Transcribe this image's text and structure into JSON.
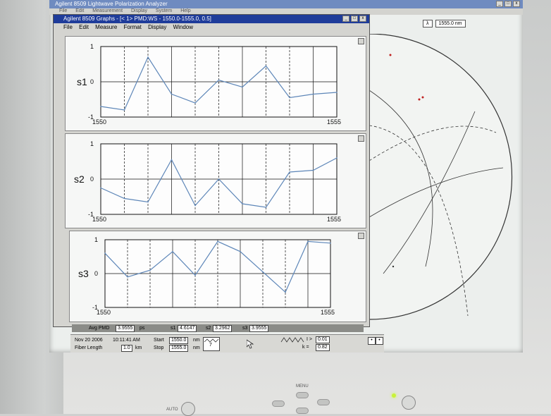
{
  "app": {
    "title": "Agilent 8509  Lightwave Polarization Analyzer",
    "menus": [
      "File",
      "Edit",
      "Measurement",
      "Display",
      "System",
      "Help"
    ],
    "win_buttons": [
      "_",
      "□",
      "x"
    ]
  },
  "lambda": {
    "symbol": "λ",
    "value": "1555.0 nm"
  },
  "graphs_window": {
    "title": "Agilent 8509 Graphs - [< 1> PMD:WS - 1550.0-1555.0, 0.5]",
    "menus": [
      "File",
      "Edit",
      "Measure",
      "Format",
      "Display",
      "Window"
    ],
    "win_buttons": [
      "_",
      "□",
      "x"
    ]
  },
  "chart_data": [
    {
      "type": "line",
      "ylabel": "s1",
      "x": [
        1550,
        1550.5,
        1551,
        1551.5,
        1552,
        1552.5,
        1553,
        1553.5,
        1554,
        1554.5,
        1555
      ],
      "values": [
        -0.7,
        -0.8,
        0.7,
        -0.35,
        -0.6,
        0.05,
        -0.15,
        0.45,
        -0.45,
        -0.35,
        -0.3
      ],
      "ylim": [
        -1,
        1
      ],
      "xlim": [
        1550,
        1555
      ],
      "yticks": [
        "1",
        "0",
        "-1"
      ],
      "xticks": [
        "1550",
        "1555"
      ]
    },
    {
      "type": "line",
      "ylabel": "s2",
      "x": [
        1550,
        1550.5,
        1551,
        1551.5,
        1552,
        1552.5,
        1553,
        1553.5,
        1554,
        1554.5,
        1555
      ],
      "values": [
        -0.25,
        -0.55,
        -0.65,
        0.55,
        -0.75,
        0.0,
        -0.7,
        -0.8,
        0.2,
        0.25,
        0.6
      ],
      "ylim": [
        -1,
        1
      ],
      "xlim": [
        1550,
        1555
      ],
      "yticks": [
        "1",
        "0",
        "-1"
      ],
      "xticks": [
        "1550",
        "1555"
      ]
    },
    {
      "type": "line",
      "ylabel": "s3",
      "x": [
        1550,
        1550.5,
        1551,
        1551.5,
        1552,
        1552.5,
        1553,
        1553.5,
        1554,
        1554.5,
        1555
      ],
      "values": [
        0.6,
        -0.1,
        0.1,
        0.65,
        -0.05,
        0.95,
        0.65,
        0.05,
        -0.55,
        0.95,
        0.9
      ],
      "ylim": [
        -1,
        1
      ],
      "xlim": [
        1550,
        1555
      ],
      "yticks": [
        "1",
        "0",
        "-1"
      ],
      "xticks": [
        "1550",
        "1555"
      ]
    }
  ],
  "status": {
    "avg_pmd_label": "Avg PMD",
    "avg_pmd_value": "3.9555",
    "avg_pmd_unit": "ps",
    "s1_label": "s1",
    "s1_value": "4.6147",
    "s2_label": "s2",
    "s2_value": "3.2962",
    "s3_label": "s3",
    "s3_value": "3.9555"
  },
  "bottom": {
    "date": "Nov 20 2006",
    "time": "10:11:41 AM",
    "fiber_length_label": "Fiber Length",
    "fiber_length_value": "1.0",
    "fiber_length_unit": "km",
    "start_label": "Start",
    "start_value": "1550.0",
    "start_unit": "nm",
    "stop_label": "Stop",
    "stop_value": "1555.0",
    "stop_unit": "nm",
    "i_label": "I >",
    "i_value": "0.01",
    "k_label": "k =",
    "k_value": "0.82",
    "steps_value": "7"
  },
  "monitor": {
    "menu_label": "MENU",
    "auto_label": "AUTO"
  },
  "colors": {
    "trace": "#5d86b8",
    "graph_title_bg": "#1f3c9a",
    "app_title_bg": "#6f8bc0",
    "led": "#c9f23a"
  }
}
